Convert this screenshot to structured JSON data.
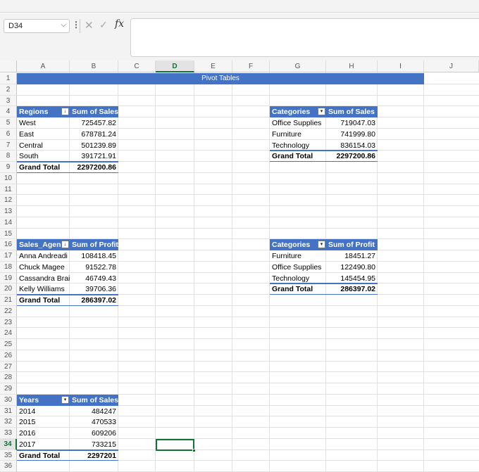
{
  "formula_bar": {
    "name_box": "D34",
    "more_icon": "⋮",
    "cancel_icon": "✕",
    "enter_icon": "✓",
    "fx_label": "fx",
    "formula": ""
  },
  "columns": [
    "A",
    "B",
    "C",
    "D",
    "E",
    "F",
    "G",
    "H",
    "I",
    "J"
  ],
  "selected_column": "D",
  "rows": [
    "1",
    "2",
    "3",
    "4",
    "5",
    "6",
    "7",
    "8",
    "9",
    "10",
    "11",
    "12",
    "13",
    "14",
    "15",
    "16",
    "17",
    "18",
    "19",
    "20",
    "21",
    "22",
    "23",
    "24",
    "25",
    "26",
    "27",
    "28",
    "29",
    "30",
    "31",
    "32",
    "33",
    "34",
    "35",
    "36"
  ],
  "selected_row": "34",
  "title": "Pivot Tables",
  "accent_color": "#4472c4",
  "pivot_regions": {
    "header": [
      "Regions",
      "Sum of Sales"
    ],
    "rows": [
      [
        "West",
        "725457.82"
      ],
      [
        "East",
        "678781.24"
      ],
      [
        "Central",
        "501239.89"
      ],
      [
        "South",
        "391721.91"
      ]
    ],
    "total": [
      "Grand Total",
      "2297200.86"
    ]
  },
  "pivot_categories_sales": {
    "header": [
      "Categories",
      "Sum of Sales"
    ],
    "rows": [
      [
        "Office Supplies",
        "719047.03"
      ],
      [
        "Furniture",
        "741999.80"
      ],
      [
        "Technology",
        "836154.03"
      ]
    ],
    "total": [
      "Grand Total",
      "2297200.86"
    ]
  },
  "pivot_agents": {
    "header": [
      "Sales_Agen",
      "Sum of Profit"
    ],
    "rows": [
      [
        "Anna Andreadi",
        "108418.45"
      ],
      [
        "Chuck Magee",
        "91522.78"
      ],
      [
        "Cassandra Brai",
        "46749.43"
      ],
      [
        "Kelly Williams",
        "39706.36"
      ]
    ],
    "total": [
      "Grand Total",
      "286397.02"
    ]
  },
  "pivot_categories_profit": {
    "header": [
      "Categories",
      "Sum of Profit"
    ],
    "rows": [
      [
        "Furniture",
        "18451.27"
      ],
      [
        "Office Supplies",
        "122490.80"
      ],
      [
        "Technology",
        "145454.95"
      ]
    ],
    "total": [
      "Grand Total",
      "286397.02"
    ]
  },
  "pivot_years": {
    "header": [
      "Years",
      "Sum of Sales"
    ],
    "rows": [
      [
        "2014",
        "484247"
      ],
      [
        "2015",
        "470533"
      ],
      [
        "2016",
        "609206"
      ],
      [
        "2017",
        "733215"
      ]
    ],
    "total": [
      "Grand Total",
      "2297201"
    ]
  }
}
